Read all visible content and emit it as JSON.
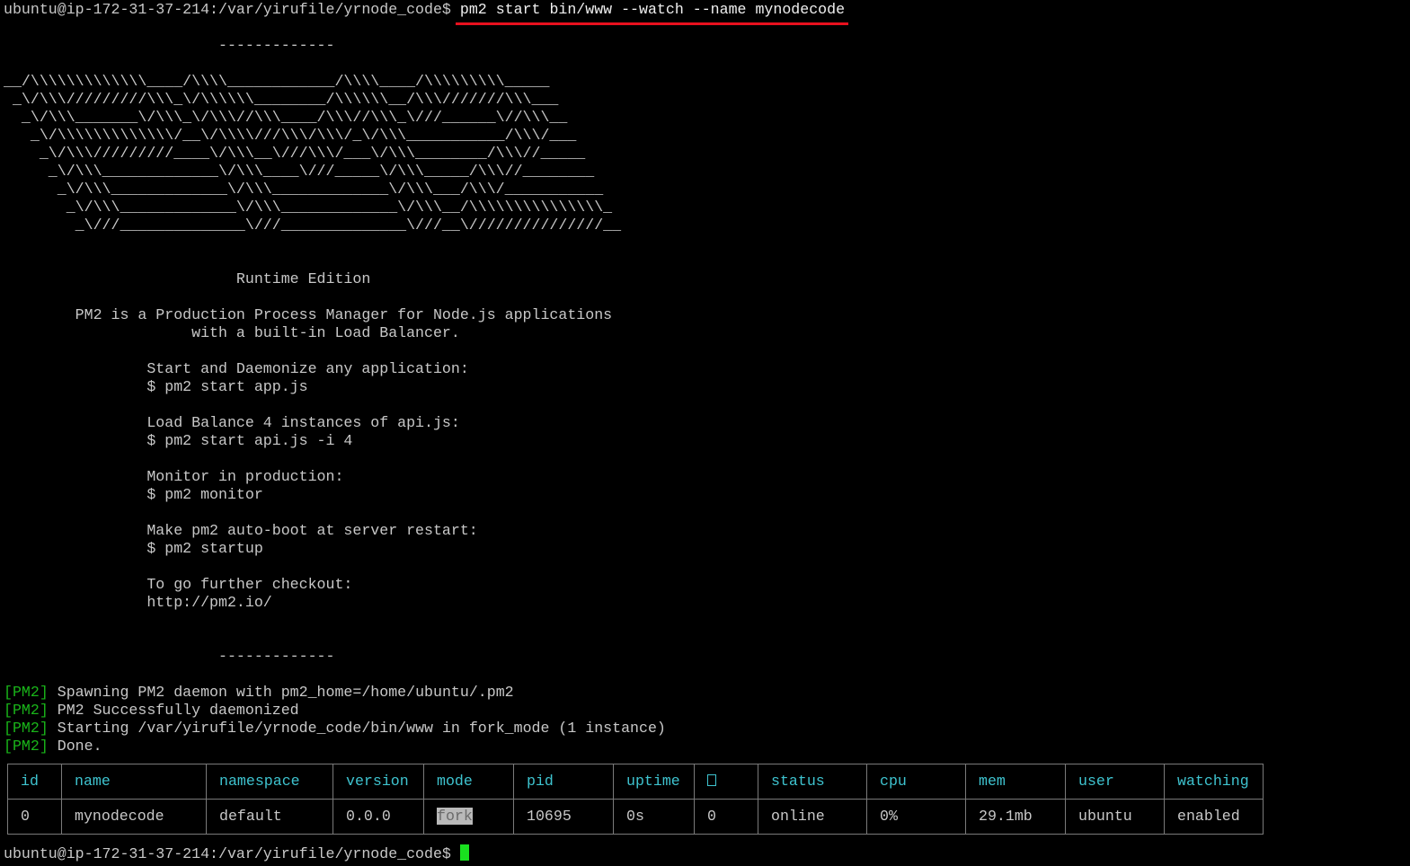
{
  "terminal": {
    "prompt": "ubuntu@ip-172-31-37-214:/var/yirufile/yrnode_code$ ",
    "command": "pm2 start bin/www --watch --name mynodecode",
    "divider_top": "                        -------------",
    "ascii_art": [
      "__/\\\\\\\\\\\\\\\\\\\\\\\\\\____/\\\\\\\\____________/\\\\\\\\____/\\\\\\\\\\\\\\\\\\_____",
      " _\\/\\\\\\/////////\\\\\\_\\/\\\\\\\\\\\\________/\\\\\\\\\\\\__/\\\\\\///////\\\\\\___",
      "  _\\/\\\\\\_______\\/\\\\\\_\\/\\\\\\//\\\\\\____/\\\\\\//\\\\\\_\\///______\\//\\\\\\__",
      "   _\\/\\\\\\\\\\\\\\\\\\\\\\\\\\/__\\/\\\\\\\\///\\\\\\/\\\\\\/_\\/\\\\\\___________/\\\\\\/___",
      "    _\\/\\\\\\/////////____\\/\\\\\\__\\///\\\\\\/___\\/\\\\\\________/\\\\\\//_____",
      "     _\\/\\\\\\_____________\\/\\\\\\____\\///_____\\/\\\\\\_____/\\\\\\//________",
      "      _\\/\\\\\\_____________\\/\\\\\\_____________\\/\\\\\\___/\\\\\\/___________",
      "       _\\/\\\\\\_____________\\/\\\\\\_____________\\/\\\\\\__/\\\\\\\\\\\\\\\\\\\\\\\\\\\\\\_",
      "        _\\///______________\\///______________\\///__\\///////////////__"
    ],
    "edition": "                          Runtime Edition",
    "intro": [
      "        PM2 is a Production Process Manager for Node.js applications",
      "                     with a built-in Load Balancer."
    ],
    "help_blocks": [
      {
        "title": "                Start and Daemonize any application:",
        "cmd": "                $ pm2 start app.js"
      },
      {
        "title": "                Load Balance 4 instances of api.js:",
        "cmd": "                $ pm2 start api.js -i 4"
      },
      {
        "title": "                Monitor in production:",
        "cmd": "                $ pm2 monitor"
      },
      {
        "title": "                Make pm2 auto-boot at server restart:",
        "cmd": "                $ pm2 startup"
      },
      {
        "title": "                To go further checkout:",
        "cmd": "                http://pm2.io/"
      }
    ],
    "divider_bottom": "                        -------------",
    "pm2_tag": "[PM2]",
    "log_lines": [
      " Spawning PM2 daemon with pm2_home=/home/ubuntu/.pm2",
      " PM2 Successfully daemonized",
      " Starting /var/yirufile/yrnode_code/bin/www in fork_mode (1 instance)",
      " Done."
    ],
    "final_prompt": "ubuntu@ip-172-31-37-214:/var/yirufile/yrnode_code$ "
  },
  "process_table": {
    "headers": [
      "id",
      "name",
      "namespace",
      "version",
      "mode",
      "pid",
      "uptime",
      "↺",
      "status",
      "cpu",
      "mem",
      "user",
      "watching"
    ],
    "row": {
      "id": "0",
      "name": "mynodecode",
      "namespace": "default",
      "version": "0.0.0",
      "mode": "fork",
      "pid": "10695",
      "uptime": "0s",
      "restarts": "0",
      "status": "online",
      "cpu": "0%",
      "mem": "29.1mb",
      "user": "ubuntu",
      "watching": "enabled"
    }
  },
  "colors": {
    "background": "#000000",
    "text": "#c8c8c8",
    "pm2_tag": "#19b419",
    "header": "#3ec3cf",
    "status_online": "#19c23a",
    "underline": "#e8101e",
    "cursor": "#19e01f"
  }
}
